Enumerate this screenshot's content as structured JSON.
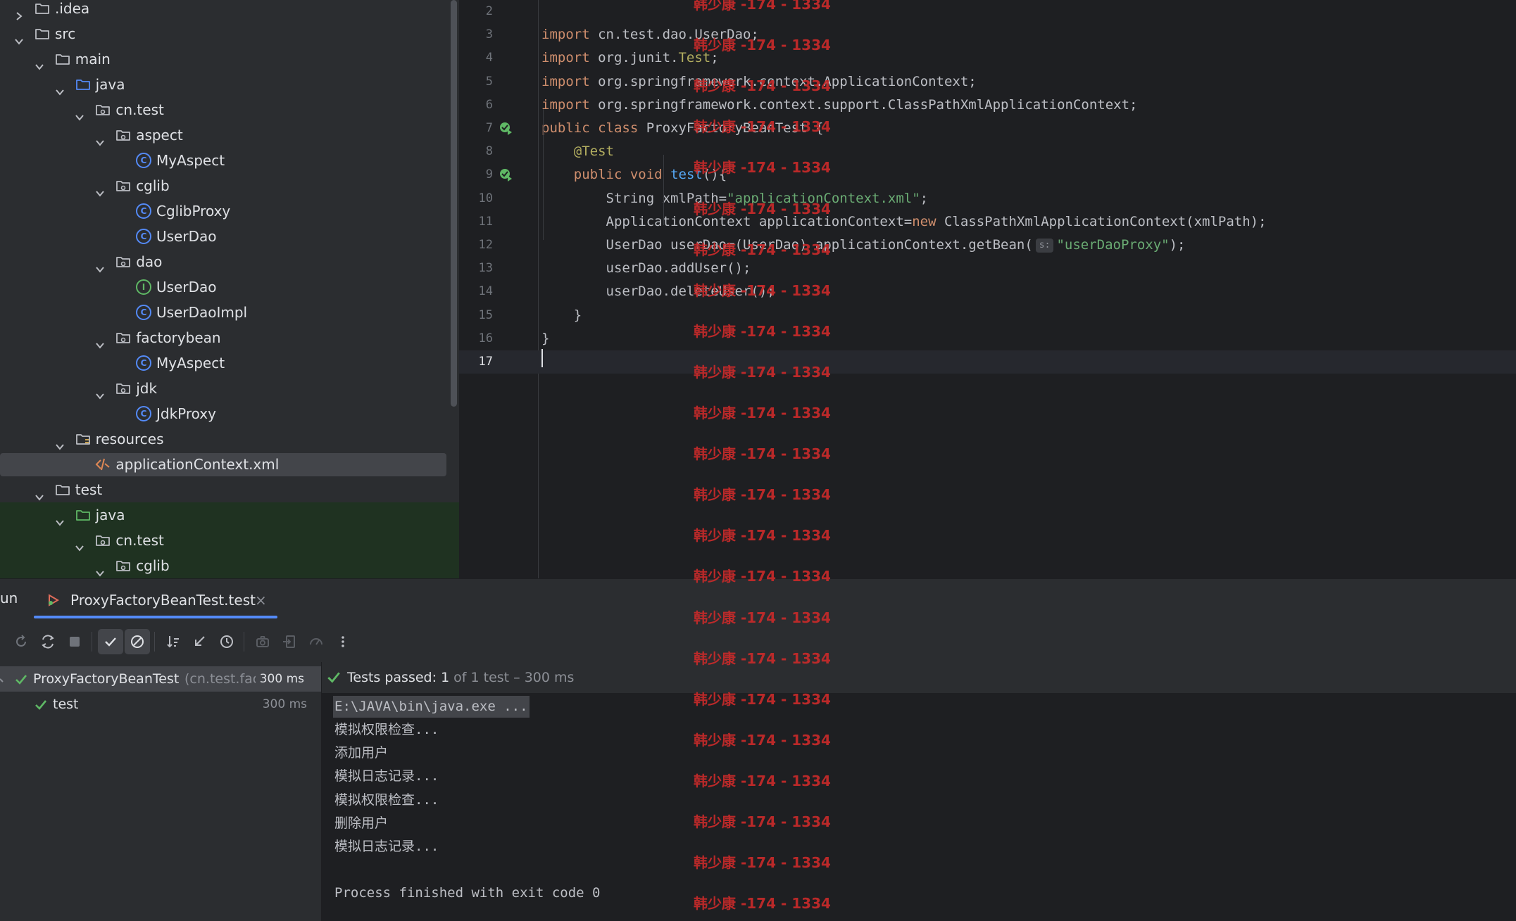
{
  "project_tree": {
    "rows": [
      {
        "label": ".idea",
        "indent": 0,
        "expanded": false,
        "icon": "folder-icon"
      },
      {
        "label": "src",
        "indent": 0,
        "expanded": true,
        "icon": "folder-icon"
      },
      {
        "label": "main",
        "indent": 1,
        "expanded": true,
        "icon": "folder-icon"
      },
      {
        "label": "java",
        "indent": 2,
        "expanded": true,
        "icon": "source-folder-icon"
      },
      {
        "label": "cn.test",
        "indent": 3,
        "expanded": true,
        "icon": "package-icon"
      },
      {
        "label": "aspect",
        "indent": 4,
        "expanded": true,
        "icon": "package-icon"
      },
      {
        "label": "MyAspect",
        "indent": 5,
        "expanded": null,
        "icon": "class-icon"
      },
      {
        "label": "cglib",
        "indent": 4,
        "expanded": true,
        "icon": "package-icon"
      },
      {
        "label": "CglibProxy",
        "indent": 5,
        "expanded": null,
        "icon": "class-icon"
      },
      {
        "label": "UserDao",
        "indent": 5,
        "expanded": null,
        "icon": "class-icon"
      },
      {
        "label": "dao",
        "indent": 4,
        "expanded": true,
        "icon": "package-icon"
      },
      {
        "label": "UserDao",
        "indent": 5,
        "expanded": null,
        "icon": "interface-icon"
      },
      {
        "label": "UserDaoImpl",
        "indent": 5,
        "expanded": null,
        "icon": "class-icon"
      },
      {
        "label": "factorybean",
        "indent": 4,
        "expanded": true,
        "icon": "package-icon"
      },
      {
        "label": "MyAspect",
        "indent": 5,
        "expanded": null,
        "icon": "class-icon"
      },
      {
        "label": "jdk",
        "indent": 4,
        "expanded": true,
        "icon": "package-icon"
      },
      {
        "label": "JdkProxy",
        "indent": 5,
        "expanded": null,
        "icon": "class-icon"
      },
      {
        "label": "resources",
        "indent": 2,
        "expanded": true,
        "icon": "resources-folder-icon"
      },
      {
        "label": "applicationContext.xml",
        "indent": 3,
        "expanded": null,
        "icon": "xml-file-icon",
        "selected": true
      },
      {
        "label": "test",
        "indent": 1,
        "expanded": true,
        "icon": "folder-icon"
      },
      {
        "label": "java",
        "indent": 2,
        "expanded": true,
        "icon": "test-source-folder-icon",
        "green": true
      },
      {
        "label": "cn.test",
        "indent": 3,
        "expanded": true,
        "icon": "package-icon",
        "green": true
      },
      {
        "label": "cglib",
        "indent": 4,
        "expanded": true,
        "icon": "package-icon",
        "green": true
      }
    ]
  },
  "editor": {
    "lines": [
      {
        "no": "2",
        "tokens": []
      },
      {
        "no": "3",
        "tokens": [
          {
            "t": "import",
            "c": "kw"
          },
          {
            "t": " cn.test.dao.UserDao;",
            "c": ""
          }
        ]
      },
      {
        "no": "4",
        "tokens": [
          {
            "t": "import",
            "c": "kw"
          },
          {
            "t": " org.junit.",
            "c": ""
          },
          {
            "t": "Test",
            "c": "ann"
          },
          {
            "t": ";",
            "c": ""
          }
        ]
      },
      {
        "no": "5",
        "tokens": [
          {
            "t": "import",
            "c": "kw"
          },
          {
            "t": " org.springframework.context.ApplicationContext;",
            "c": ""
          }
        ]
      },
      {
        "no": "6",
        "tokens": [
          {
            "t": "import",
            "c": "kw"
          },
          {
            "t": " org.springframework.context.support.ClassPathXmlApplicationContext;",
            "c": ""
          }
        ]
      },
      {
        "no": "7",
        "run_icon": true,
        "tokens": [
          {
            "t": "public class",
            "c": "kw"
          },
          {
            "t": " ProxyFactoryBeanTest {",
            "c": ""
          }
        ]
      },
      {
        "no": "8",
        "tokens": [
          {
            "t": "    ",
            "c": ""
          },
          {
            "t": "@Test",
            "c": "ann"
          }
        ]
      },
      {
        "no": "9",
        "run_icon": true,
        "tokens": [
          {
            "t": "    ",
            "c": ""
          },
          {
            "t": "public void",
            "c": "kw"
          },
          {
            "t": " ",
            "c": ""
          },
          {
            "t": "test",
            "c": "fn"
          },
          {
            "t": "(){",
            "c": ""
          }
        ]
      },
      {
        "no": "10",
        "tokens": [
          {
            "t": "        String xmlPath=",
            "c": ""
          },
          {
            "t": "\"applicationContext.xml\"",
            "c": "str"
          },
          {
            "t": ";",
            "c": ""
          }
        ]
      },
      {
        "no": "11",
        "tokens": [
          {
            "t": "        ApplicationContext applicationContext=",
            "c": ""
          },
          {
            "t": "new",
            "c": "kw"
          },
          {
            "t": " ClassPathXmlApplicationContext(xmlPath);",
            "c": ""
          }
        ]
      },
      {
        "no": "12",
        "tokens": [
          {
            "t": "        UserDao userDao=(UserDao) applicationContext.getBean(",
            "c": ""
          },
          {
            "t": "s:",
            "c": "hint"
          },
          {
            "t": "\"userDaoProxy\"",
            "c": "str"
          },
          {
            "t": ");",
            "c": ""
          }
        ]
      },
      {
        "no": "13",
        "tokens": [
          {
            "t": "        userDao.addUser();",
            "c": ""
          }
        ]
      },
      {
        "no": "14",
        "tokens": [
          {
            "t": "        userDao.deleteUser();",
            "c": ""
          }
        ]
      },
      {
        "no": "15",
        "tokens": [
          {
            "t": "    }",
            "c": ""
          }
        ]
      },
      {
        "no": "16",
        "tokens": [
          {
            "t": "}",
            "c": ""
          }
        ]
      },
      {
        "no": "17",
        "tokens": [],
        "current": true
      }
    ]
  },
  "run_window": {
    "label": "un",
    "tab_name": "ProxyFactoryBeanTest.test",
    "tab_close": "×",
    "test_tree": {
      "root": {
        "name": "ProxyFactoryBeanTest",
        "pkg": "(cn.test.fac",
        "time": "300 ms"
      },
      "child": {
        "name": "test",
        "time": "300 ms"
      }
    },
    "status": {
      "prefix": "Tests passed:",
      "count": "1",
      "detail": "of 1 test – 300 ms"
    },
    "console": [
      "E:\\JAVA\\bin\\java.exe ...",
      "模拟权限检查...",
      "添加用户",
      "模拟日志记录...",
      "模拟权限检查...",
      "删除用户",
      "模拟日志记录...",
      "",
      "Process finished with exit code 0"
    ]
  },
  "watermark": {
    "text": "韩少康 -174 - 1334",
    "color": "#c82a2a",
    "count": 23
  },
  "colors": {
    "accent": "#548af7",
    "success": "#5fb865",
    "keyword": "#cf8e6d",
    "string": "#6aab73",
    "annotation": "#b3ae60"
  }
}
